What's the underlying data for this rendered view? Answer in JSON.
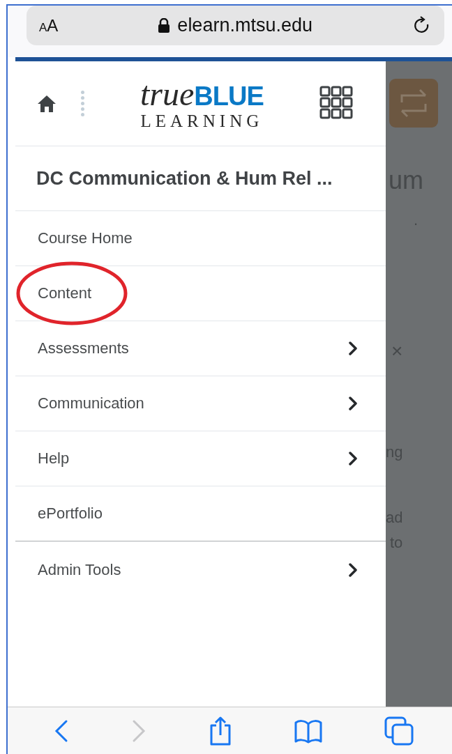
{
  "browser": {
    "text_size_button": "AA",
    "url": "elearn.mtsu.edu"
  },
  "header": {
    "logo": {
      "word_1": "true",
      "word_2": "BLUE",
      "word_3": "LEARNING"
    }
  },
  "course_title": "DC Communication & Hum Rel ...",
  "menu": [
    {
      "label": "Course Home",
      "has_submenu": false,
      "circled": false
    },
    {
      "label": "Content",
      "has_submenu": false,
      "circled": true
    },
    {
      "label": "Assessments",
      "has_submenu": true,
      "circled": false
    },
    {
      "label": "Communication",
      "has_submenu": true,
      "circled": false
    },
    {
      "label": "Help",
      "has_submenu": true,
      "circled": false
    },
    {
      "label": "ePortfolio",
      "has_submenu": false,
      "circled": false
    },
    {
      "label": "Admin Tools",
      "has_submenu": true,
      "circled": false
    }
  ],
  "background_page": {
    "fragments": [
      "um",
      ".",
      "×",
      "ng",
      "ad",
      "to"
    ]
  },
  "toolbar": {
    "forward_disabled": true
  }
}
